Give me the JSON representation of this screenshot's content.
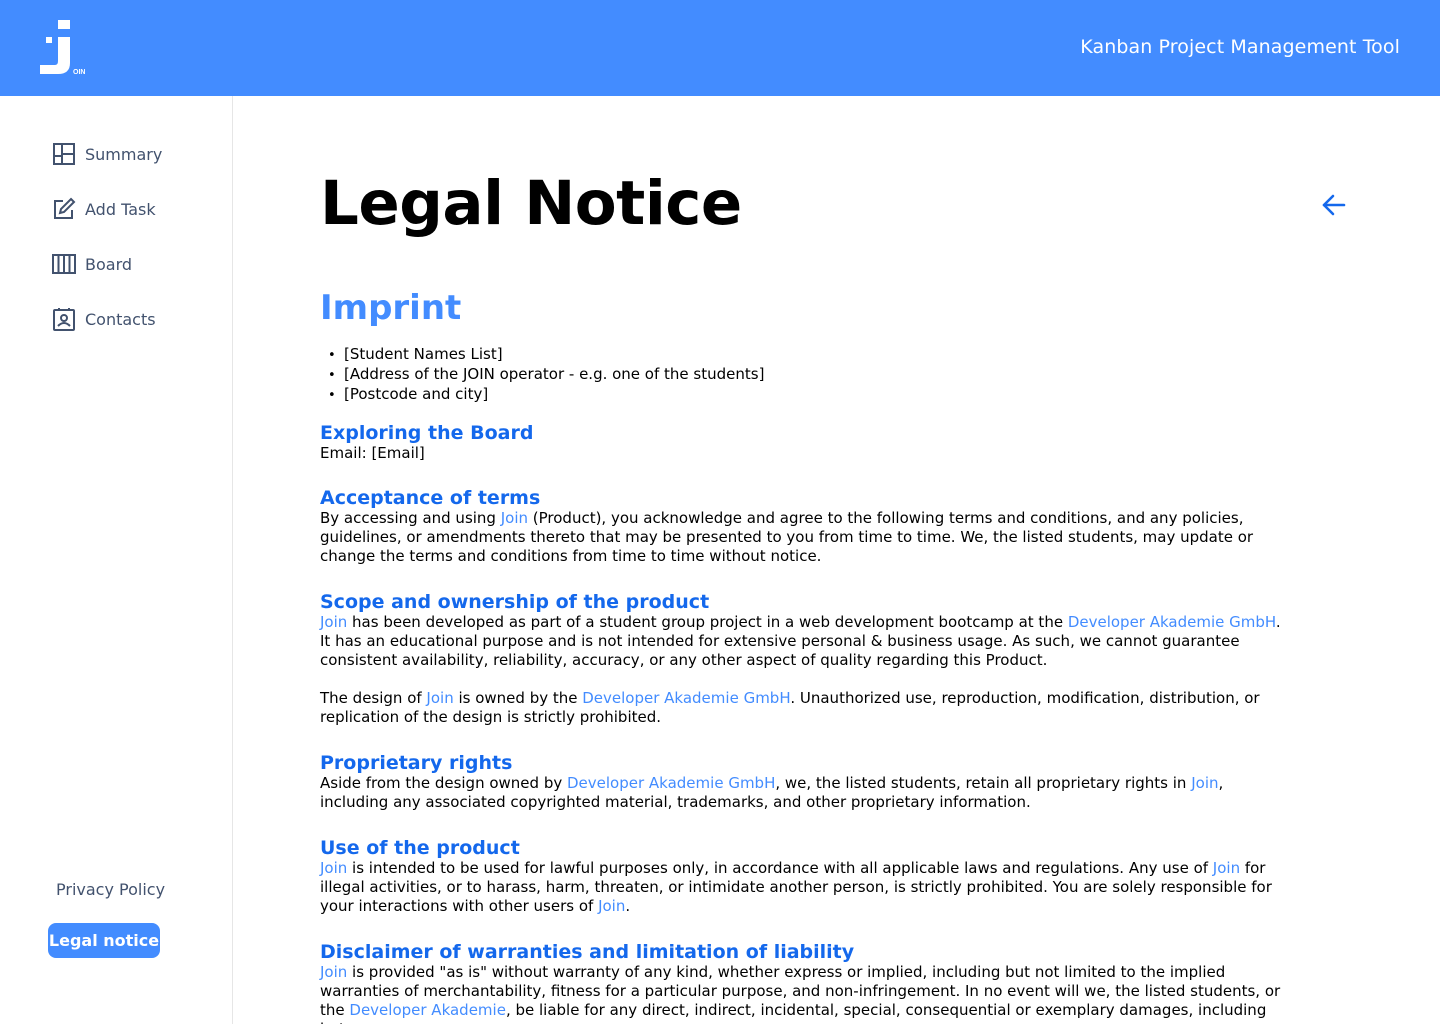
{
  "header": {
    "title": "Kanban Project Management Tool",
    "logo_text": "JOIN"
  },
  "sidebar": {
    "items": [
      {
        "label": "Summary",
        "icon": "summary-icon"
      },
      {
        "label": "Add Task",
        "icon": "add-task-icon"
      },
      {
        "label": "Board",
        "icon": "board-icon"
      },
      {
        "label": "Contacts",
        "icon": "contacts-icon"
      }
    ],
    "privacy_label": "Privacy Policy",
    "legal_label": "Legal notice"
  },
  "main": {
    "title": "Legal Notice",
    "imprint": {
      "heading": "Imprint",
      "items": [
        "[Student Names List]",
        "[Address of the JOIN operator - e.g. one of the students]",
        "[Postcode and city]"
      ]
    },
    "sections": {
      "board": {
        "heading": "Exploring the Board",
        "text": "Email: [Email]"
      },
      "acceptance": {
        "heading": "Acceptance of terms",
        "t1": "By accessing and using ",
        "l1": "Join",
        "t2": " (Product), you acknowledge and agree to the following terms and conditions, and any policies, guidelines, or amendments thereto that may be presented to you from time to time. We, the listed students, may update or change the terms and conditions from time to time without notice."
      },
      "scope": {
        "heading": "Scope and ownership of the product",
        "l1": "Join",
        "t1": " has been developed as part of a student group project in a web development bootcamp at the ",
        "l2": "Developer Akademie GmbH",
        "t2": ". It has an educational purpose and is not intended for extensive personal & business usage. As such, we cannot guarantee consistent availability, reliability, accuracy, or any other aspect of quality regarding this Product.",
        "t3": "The design of ",
        "l3": "Join",
        "t4": " is owned by the ",
        "l4": "Developer Akademie GmbH",
        "t5": ". Unauthorized use, reproduction, modification, distribution, or replication of the design is strictly prohibited."
      },
      "rights": {
        "heading": "Proprietary rights",
        "t1": "Aside from the design owned by ",
        "l1": "Developer Akademie GmbH",
        "t2": ", we, the listed students, retain all proprietary rights in ",
        "l2": "Join",
        "t3": ", including any associated copyrighted material, trademarks, and other proprietary information."
      },
      "use": {
        "heading": "Use of the product",
        "l1": "Join",
        "t1": " is intended to be used for lawful purposes only, in accordance with all applicable laws and regulations. Any use of ",
        "l2": "Join",
        "t2": " for illegal activities, or to harass, harm, threaten, or intimidate another person, is strictly prohibited. You are solely responsible for your interactions with other users of ",
        "l3": "Join",
        "t3": "."
      },
      "disclaimer": {
        "heading": "Disclaimer of warranties and limitation of liability",
        "l1": "Join",
        "t1": " is provided \"as is\" without warranty of any kind, whether express or implied, including but not limited to the implied warranties of merchantability, fitness for a particular purpose, and non-infringement. In no event will we, the listed students, or the ",
        "l2": "Developer Akademie",
        "t2": ", be liable for any direct, indirect, incidental, special, consequential or exemplary damages, including but"
      }
    }
  }
}
